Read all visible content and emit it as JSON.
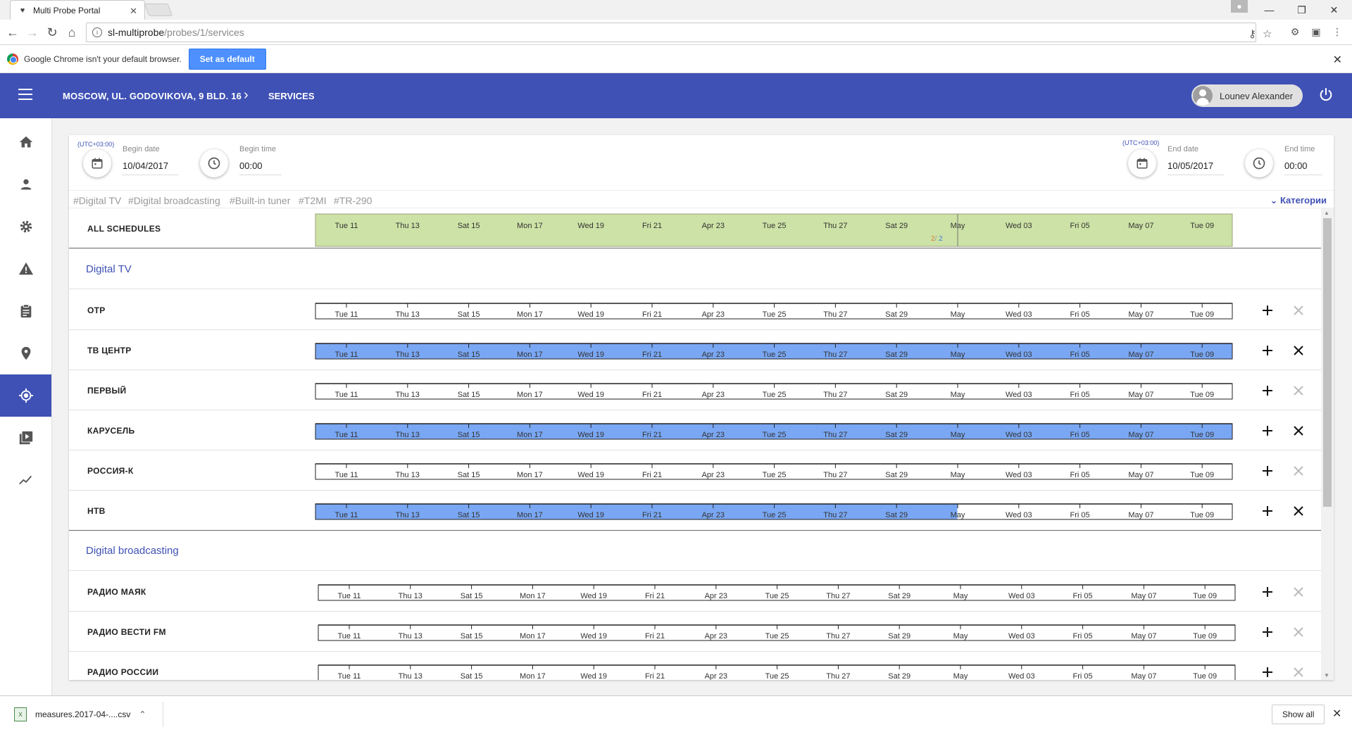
{
  "browser": {
    "tab_title": "Multi Probe Portal",
    "url_host": "sl-multiprobe",
    "url_path": "/probes/1/services",
    "infobar_text": "Google Chrome isn't your default browser.",
    "infobar_button": "Set as default"
  },
  "header": {
    "location": "MOSCOW, UL. GODOVIKOVA, 9 BLD. 16",
    "page": "SERVICES",
    "user_name": "Lounev Alexander"
  },
  "filters": {
    "begin_tz": "(UTC+03:00)",
    "begin_date_label": "Begin date",
    "begin_date": "10/04/2017",
    "begin_time_label": "Begin time",
    "begin_time": "00:00",
    "end_tz": "(UTC+03:00)",
    "end_date_label": "End date",
    "end_date": "10/05/2017",
    "end_time_label": "End time",
    "end_time": "00:00"
  },
  "tags": [
    "#Digital TV",
    "#Digital broadcasting",
    "#Built-in tuner",
    "#T2MI",
    "#TR-290"
  ],
  "categories_label": "Категории",
  "timeline": {
    "ticks": [
      "Tue 11",
      "Thu 13",
      "Sat 15",
      "Mon 17",
      "Wed 19",
      "Fri 21",
      "Apr 23",
      "Tue 25",
      "Thu 27",
      "Sat 29",
      "May",
      "Wed 03",
      "Fri 05",
      "May 07",
      "Tue 09"
    ],
    "total_days": 30,
    "colors": {
      "all": "#cde2a6",
      "active": "#7aa7f3",
      "inactive": "#ffffff"
    }
  },
  "all_schedules": {
    "label": "ALL SCHEDULES",
    "counter_a": "2",
    "counter_sep": "/",
    "counter_b": "2"
  },
  "groups": [
    {
      "name": "Digital TV",
      "services": [
        {
          "name": "ОТР",
          "coverage": 0
        },
        {
          "name": "ТВ ЦЕНТР",
          "coverage": 1
        },
        {
          "name": "ПЕРВЫЙ",
          "coverage": 0
        },
        {
          "name": "КАРУСЕЛЬ",
          "coverage": 1
        },
        {
          "name": "РОССИЯ-К",
          "coverage": 0
        },
        {
          "name": "НТВ",
          "coverage": 0.667
        }
      ]
    },
    {
      "name": "Digital broadcasting",
      "services": [
        {
          "name": "РАДИО МАЯК",
          "coverage": 0
        },
        {
          "name": "РАДИО ВЕСТИ FM",
          "coverage": 0
        },
        {
          "name": "РАДИО РОССИИ",
          "coverage": 0
        }
      ]
    }
  ],
  "downloads": {
    "file": "measures.2017-04-....csv",
    "show_all": "Show all"
  }
}
